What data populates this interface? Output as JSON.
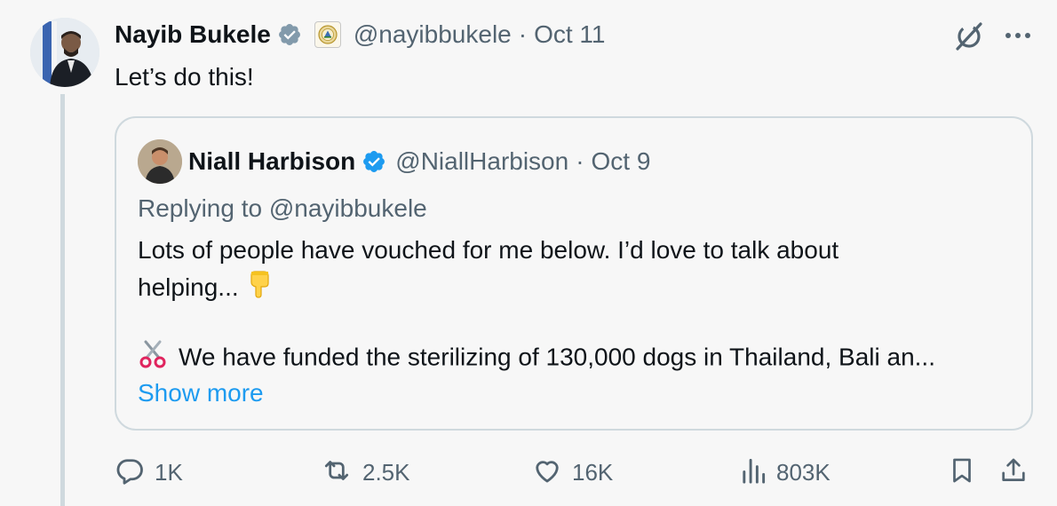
{
  "tweet": {
    "author_name": "Nayib Bukele",
    "handle": "@nayibbukele",
    "separator": "·",
    "date": "Oct 11",
    "text": "Let’s do this!",
    "verified_color": "#829aab",
    "icons": [
      "avatar",
      "verified-badge-icon",
      "affiliation-badge-icon",
      "grok-icon",
      "more-icon"
    ]
  },
  "quote": {
    "author_name": "Niall Harbison",
    "handle": "@NiallHarbison",
    "separator": "·",
    "date": "Oct 9",
    "reply_to": "Replying to @nayibbukele",
    "body_line1": "Lots of people have vouched for me below. I’d love to talk about",
    "body_line2": "helping...",
    "body_line3": "We have funded the sterilizing of 130,000 dogs in Thailand, Bali an...",
    "show_more": "Show more",
    "verified_color": "#1d9bf0",
    "emojis": [
      "pointing-down-emoji",
      "scissors-emoji"
    ]
  },
  "actions": {
    "replies": "1K",
    "reposts": "2.5K",
    "likes": "16K",
    "views": "803K",
    "icons": [
      "reply-icon",
      "repost-icon",
      "like-icon",
      "views-icon",
      "bookmark-icon",
      "share-icon"
    ]
  },
  "colors": {
    "background": "#f7f7f7",
    "text": "#0f1419",
    "secondary": "#536471",
    "link": "#1d9bf0",
    "border": "#cfd9de"
  }
}
